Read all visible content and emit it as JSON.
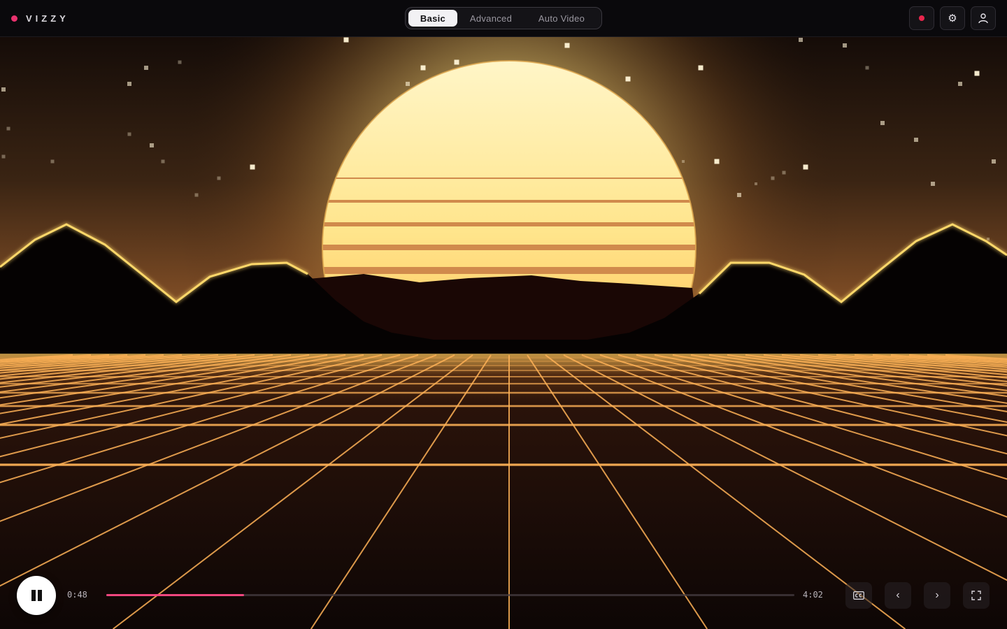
{
  "app": {
    "name": "VIZZY",
    "brand_color": "#e8326e"
  },
  "header": {
    "mode_tabs": [
      {
        "label": "Basic",
        "active": true
      },
      {
        "label": "Advanced",
        "active": false
      },
      {
        "label": "Auto Video",
        "active": false
      }
    ],
    "record_color": "#e8264d",
    "actions": [
      "record-icon",
      "gear-icon",
      "user-icon"
    ]
  },
  "player": {
    "state": "playing",
    "current_time": "0:48",
    "duration": "4:02",
    "progress_fraction": 0.2,
    "progress_color": "#f0477f",
    "controls": [
      "captions-icon",
      "chevron-left-icon",
      "chevron-right-icon",
      "fullscreen-icon"
    ]
  },
  "scene": {
    "sun_color": "#fff3a8",
    "grid_color": "#ffb257",
    "mountain_outline_color": "#ffd86a"
  }
}
